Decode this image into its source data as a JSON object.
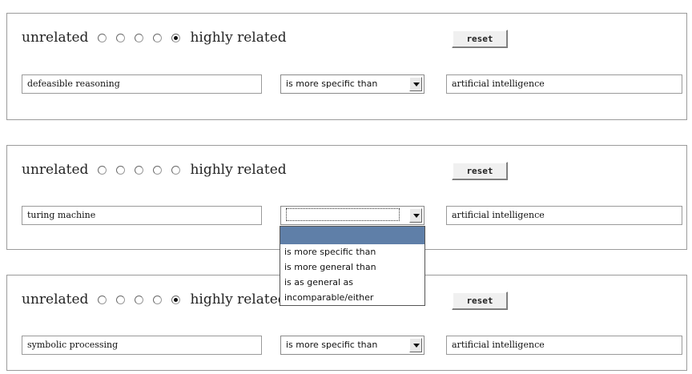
{
  "rows": [
    {
      "rating": {
        "left_label": "unrelated",
        "right_label": "highly related",
        "options": 5,
        "checked": 5
      },
      "reset_label": "reset",
      "term1": "defeasible reasoning",
      "relation": "is more specific than",
      "term2": "artificial intelligence"
    },
    {
      "rating": {
        "left_label": "unrelated",
        "right_label": "highly related",
        "options": 5,
        "checked": 0
      },
      "reset_label": "reset",
      "term1": "turing machine",
      "relation": "",
      "term2": "artificial intelligence"
    },
    {
      "rating": {
        "left_label": "unrelated",
        "right_label": "highly related",
        "options": 5,
        "checked": 5
      },
      "reset_label": "reset",
      "term1": "symbolic processing",
      "relation": "is more specific than",
      "term2": "artificial intelligence"
    }
  ],
  "dropdown": {
    "options": [
      "",
      "is more specific than",
      "is more general than",
      "is as general as",
      "incomparable/either"
    ],
    "highlighted_index": 0
  }
}
